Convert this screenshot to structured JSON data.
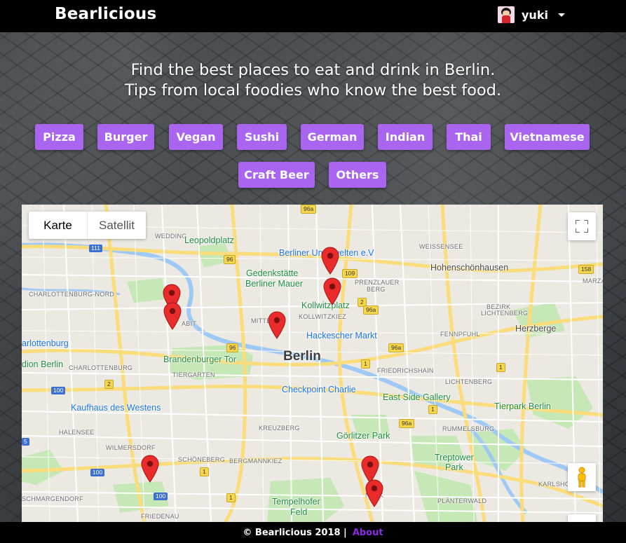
{
  "navbar": {
    "brand": "Bearlicious",
    "user": {
      "name": "yuki",
      "avatar_icon": "user-avatar-icon"
    }
  },
  "hero": {
    "line1": "Find the best places to eat and drink in Berlin.",
    "line2": "Tips from local foodies who know the best food."
  },
  "categories": [
    "Pizza",
    "Burger",
    "Vegan",
    "Sushi",
    "German",
    "Indian",
    "Thai",
    "Vietnamese",
    "Craft Beer",
    "Others"
  ],
  "colors": {
    "button": "#a965f0",
    "navbar": "#000000",
    "footer_link": "#8a2be2",
    "pin": "#ea2b2b"
  },
  "map": {
    "type_control": {
      "map_label": "Karte",
      "satellite_label": "Satellit",
      "selected": "Karte"
    },
    "labels": {
      "city": "Berlin",
      "wedding": "WEDDING",
      "leopoldplatz": "Leopoldplatz",
      "berliner_unterwelten": "Berliner Unterwelten e.V",
      "weissensee": "WEISSENSEE",
      "hohenschoenhausen": "Hohenschönhausen",
      "gedenkstaette": "Gedenkstätte",
      "berliner_mauer": "Berliner Mauer",
      "prenzlauer_berg": "PRENZLAUER",
      "prenzlauer_berg2": "BERG",
      "charlottenburg_nord": "CHARLOTTENBURG-NORD",
      "kollwitzplatz": "Kollwitzplatz",
      "kollwitzkiez": "KOLLWITZKIEZ",
      "bezirk_lichtenberg": "BEZIRK",
      "bezirk_lichtenberg2": "LICHTENBERG",
      "moabit": "ABIT",
      "mitte": "MITTE",
      "herzberge": "Herzberge",
      "hackescher_markt": "Hackescher Markt",
      "fennpfuhl": "FENNPFUHL",
      "charlottenburg": "arlottenburg",
      "brandenburger_tor": "Brandenburger Tor",
      "friedrichshain": "FRIEDRICHSHAIN",
      "stadion_berlin": "dion Berlin",
      "charlottenburg2": "CHARLOTTENBURG",
      "tiergarten": "TIERGARTEN",
      "lichtenberg": "LICHTENBERG",
      "checkpoint_charlie": "Checkpoint Charlie",
      "kaufhaus_des_westens": "Kaufhaus des Westens",
      "east_side_gallery": "East Side Gallery",
      "tierpark_berlin": "Tierpark Berlin",
      "rummelsburg": "RUMMELSBURG",
      "kreuzberg": "KREUZBERG",
      "halensee": "HALENSEE",
      "goerlitzer_park": "Görlitzer Park",
      "wilmersdorf": "WILMERSDORF",
      "treptower_park": "Treptower",
      "treptower_park2": "Park",
      "schoeneberg": "SCHÖNEBERG",
      "bergmannkiez": "BERGMANNKIEZ",
      "karlshorst": "KARLSHO",
      "schmargendorf": "SCHMARGENDORF",
      "neukoelln": "NEUK",
      "plaenterwald": "PLÄNTERWALD",
      "tempelhofer_feld": "Tempelhofer",
      "tempelhofer_feld2": "Feld",
      "friedenau": "FRIEDENAU",
      "marzahn": "MARZA"
    },
    "road_shields": {
      "r96a_top": "96a",
      "r111": "111",
      "r96_wedding": "96",
      "r109": "109",
      "r158": "158",
      "r2_prenzl": "2",
      "r96a_mid": "96a",
      "r96_mitte": "96",
      "r96a_east": "96a",
      "r1_mitte": "1",
      "r1_east": "1",
      "r2_tier": "2",
      "r100_west": "100",
      "r96a_south": "96a",
      "r1_frh": "1",
      "r5_west": "5",
      "r1_schoen": "1",
      "r100_sw": "100",
      "r100_s": "100",
      "r1_sw": "1"
    },
    "pins": 8,
    "controls": {
      "fullscreen_icon": "fullscreen-icon",
      "pegman_icon": "pegman-icon",
      "zoom_in_icon": "zoom-in-icon"
    }
  },
  "footer": {
    "copyright": "© Bearlicious 2018 |",
    "about_label": "About"
  }
}
